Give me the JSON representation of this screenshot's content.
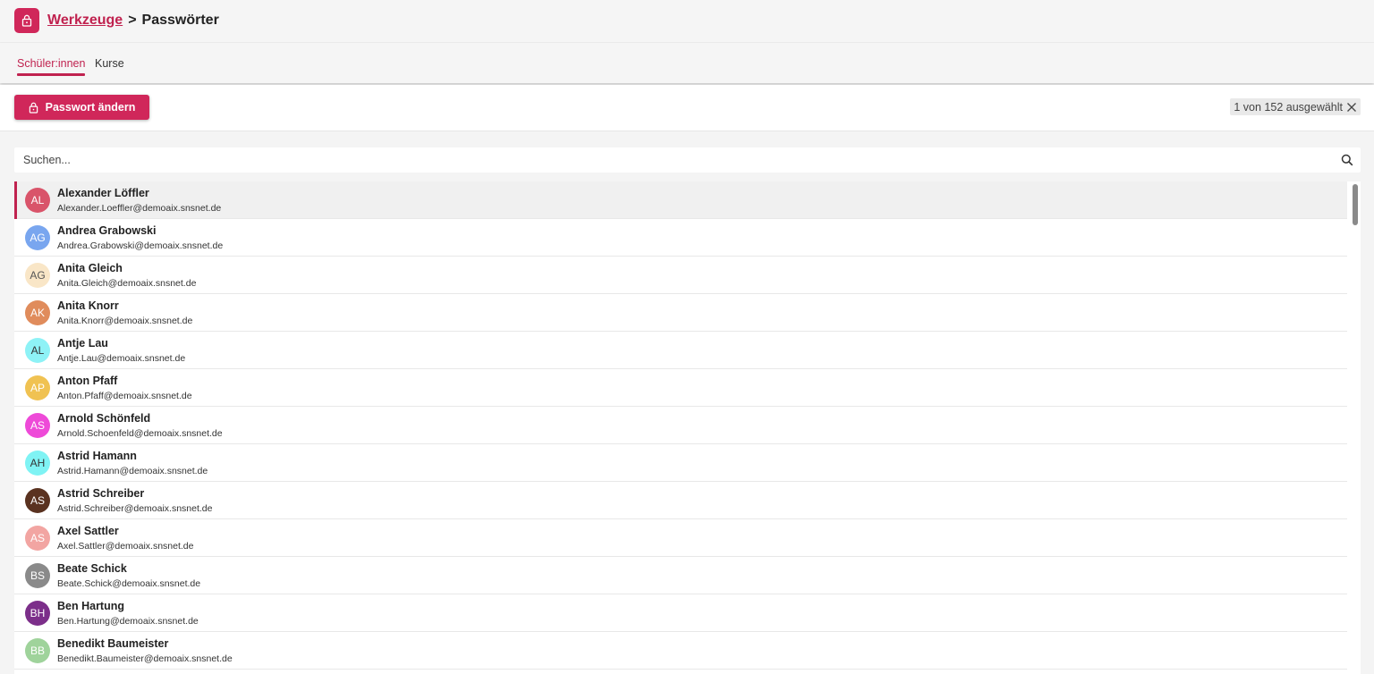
{
  "header": {
    "app_icon": "lock-icon",
    "breadcrumb_parent": "Werkzeuge",
    "breadcrumb_separator": ">",
    "breadcrumb_current": "Passwörter"
  },
  "tabs": [
    {
      "label": "Schüler:innen",
      "active": true
    },
    {
      "label": "Kurse",
      "active": false
    }
  ],
  "toolbar": {
    "change_password_label": "Passwort ändern",
    "selection_text": "1 von 152 ausgewählt",
    "clear_icon": "close-icon"
  },
  "search": {
    "placeholder": "Suchen...",
    "value": ""
  },
  "colors": {
    "accent": "#d0275a",
    "accent_text": "#c0224f"
  },
  "users": [
    {
      "initials": "AL",
      "name": "Alexander Löffler",
      "email": "Alexander.Loeffler@demoaix.snsnet.de",
      "color": "#d9546a",
      "text_color": "#ffffff",
      "selected": true
    },
    {
      "initials": "AG",
      "name": "Andrea Grabowski",
      "email": "Andrea.Grabowski@demoaix.snsnet.de",
      "color": "#79a6ef",
      "text_color": "#ffffff",
      "selected": false
    },
    {
      "initials": "AG",
      "name": "Anita Gleich",
      "email": "Anita.Gleich@demoaix.snsnet.de",
      "color": "#f9e6c7",
      "text_color": "#555555",
      "selected": false
    },
    {
      "initials": "AK",
      "name": "Anita Knorr",
      "email": "Anita.Knorr@demoaix.snsnet.de",
      "color": "#e08c5c",
      "text_color": "#ffffff",
      "selected": false
    },
    {
      "initials": "AL",
      "name": "Antje Lau",
      "email": "Antje.Lau@demoaix.snsnet.de",
      "color": "#8ef2f6",
      "text_color": "#333333",
      "selected": false
    },
    {
      "initials": "AP",
      "name": "Anton Pfaff",
      "email": "Anton.Pfaff@demoaix.snsnet.de",
      "color": "#f0c252",
      "text_color": "#ffffff",
      "selected": false
    },
    {
      "initials": "AS",
      "name": "Arnold Schönfeld",
      "email": "Arnold.Schoenfeld@demoaix.snsnet.de",
      "color": "#ee4ad8",
      "text_color": "#ffffff",
      "selected": false
    },
    {
      "initials": "AH",
      "name": "Astrid Hamann",
      "email": "Astrid.Hamann@demoaix.snsnet.de",
      "color": "#7ff3f4",
      "text_color": "#333333",
      "selected": false
    },
    {
      "initials": "AS",
      "name": "Astrid Schreiber",
      "email": "Astrid.Schreiber@demoaix.snsnet.de",
      "color": "#5a3220",
      "text_color": "#ffffff",
      "selected": false
    },
    {
      "initials": "AS",
      "name": "Axel Sattler",
      "email": "Axel.Sattler@demoaix.snsnet.de",
      "color": "#f2a5a2",
      "text_color": "#ffffff",
      "selected": false
    },
    {
      "initials": "BS",
      "name": "Beate Schick",
      "email": "Beate.Schick@demoaix.snsnet.de",
      "color": "#8a8a8a",
      "text_color": "#ffffff",
      "selected": false
    },
    {
      "initials": "BH",
      "name": "Ben Hartung",
      "email": "Ben.Hartung@demoaix.snsnet.de",
      "color": "#7c2f8a",
      "text_color": "#ffffff",
      "selected": false
    },
    {
      "initials": "BB",
      "name": "Benedikt Baumeister",
      "email": "Benedikt.Baumeister@demoaix.snsnet.de",
      "color": "#9fd39b",
      "text_color": "#ffffff",
      "selected": false
    }
  ]
}
